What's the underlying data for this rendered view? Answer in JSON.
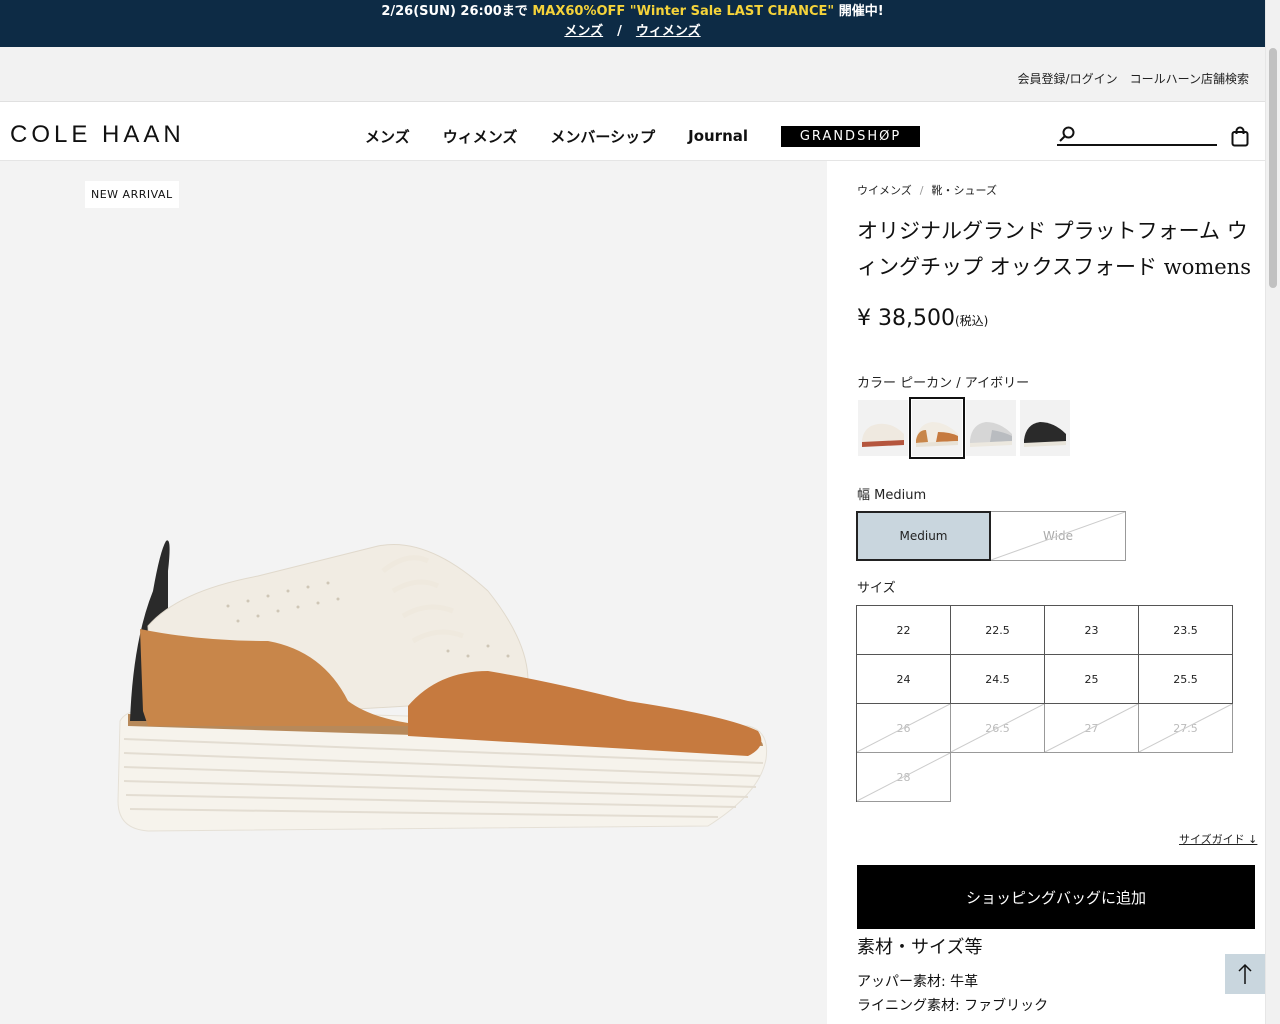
{
  "promo": {
    "prefix": "2/26(SUN) 26:00まで ",
    "highlight": "MAX60%OFF \"Winter Sale LAST CHANCE\"",
    "suffix": " 開催中!",
    "link_mens": "メンズ",
    "separator": "/",
    "link_womens": "ウィメンズ"
  },
  "utility": {
    "login": "会員登録/ログイン",
    "store_search": "コールハーン店舗検索"
  },
  "header": {
    "logo": "COLE HAAN",
    "nav": [
      "メンズ",
      "ウィメンズ",
      "メンバーシップ",
      "Journal"
    ],
    "grandshop": "GRANDSHØP",
    "search_placeholder": ""
  },
  "gallery": {
    "badge": "NEW ARRIVAL"
  },
  "product": {
    "breadcrumb": [
      "ウイメンズ",
      "靴・シューズ"
    ],
    "title": "オリジナルグランド プラットフォーム ウィングチップ オックスフォード womens",
    "price": "¥ 38,500",
    "tax_note": "(税込)",
    "color_label": "カラー ピーカン / アイボリー",
    "swatches": [
      {
        "name": "ivory-brown",
        "selected": false
      },
      {
        "name": "pecan-ivory",
        "selected": true
      },
      {
        "name": "silver",
        "selected": false
      },
      {
        "name": "black",
        "selected": false
      }
    ],
    "width_label": "幅 Medium",
    "widths": [
      {
        "label": "Medium",
        "selected": true,
        "available": true
      },
      {
        "label": "Wide",
        "selected": false,
        "available": false
      }
    ],
    "size_label": "サイズ",
    "sizes": [
      {
        "label": "22",
        "available": true
      },
      {
        "label": "22.5",
        "available": true
      },
      {
        "label": "23",
        "available": true
      },
      {
        "label": "23.5",
        "available": true
      },
      {
        "label": "24",
        "available": true
      },
      {
        "label": "24.5",
        "available": true
      },
      {
        "label": "25",
        "available": true
      },
      {
        "label": "25.5",
        "available": true
      },
      {
        "label": "26",
        "available": false
      },
      {
        "label": "26.5",
        "available": false
      },
      {
        "label": "27",
        "available": false
      },
      {
        "label": "27.5",
        "available": false
      },
      {
        "label": "28",
        "available": false
      }
    ],
    "size_guide": "サイズガイド ↓",
    "add_to_bag": "ショッピングバッグに追加",
    "spec_heading": "素材・サイズ等",
    "specs": [
      "アッパー素材: 牛革",
      "ライニング素材: ファブリック"
    ]
  },
  "colors": {
    "promo_bg": "#0d2b45",
    "promo_highlight": "#f5d33a",
    "selected_width_bg": "#c9d6de",
    "cta_bg": "#000000"
  }
}
